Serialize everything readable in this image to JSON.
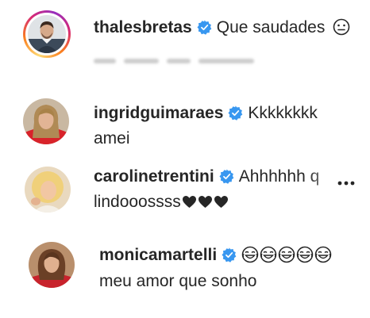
{
  "comments": [
    {
      "username": "thalesbretas",
      "text": "Que saudades",
      "verified": true,
      "has_story": true,
      "trailing_emoji": "neutral-face-emoji"
    },
    {
      "username": "ingridguimaraes",
      "text": "Kkkkkkkk",
      "text_line2": "amei",
      "verified": true
    },
    {
      "username": "carolinetrentini",
      "text": "Ahhhhhh q",
      "text_line2": "lindooossss",
      "verified": true,
      "trailing_emoji": "black-heart-emoji"
    },
    {
      "username": "monicamartelli",
      "text": "",
      "text_line2": "meu amor que sonho",
      "verified": true,
      "emoji_count": 5,
      "emoji": "laughing-tears-emoji"
    }
  ],
  "colors": {
    "verified_blue": "#3897f0",
    "text": "#262626",
    "secondary": "#8e8e8e"
  },
  "icons": [
    "verified-badge-icon",
    "more-options-icon"
  ]
}
